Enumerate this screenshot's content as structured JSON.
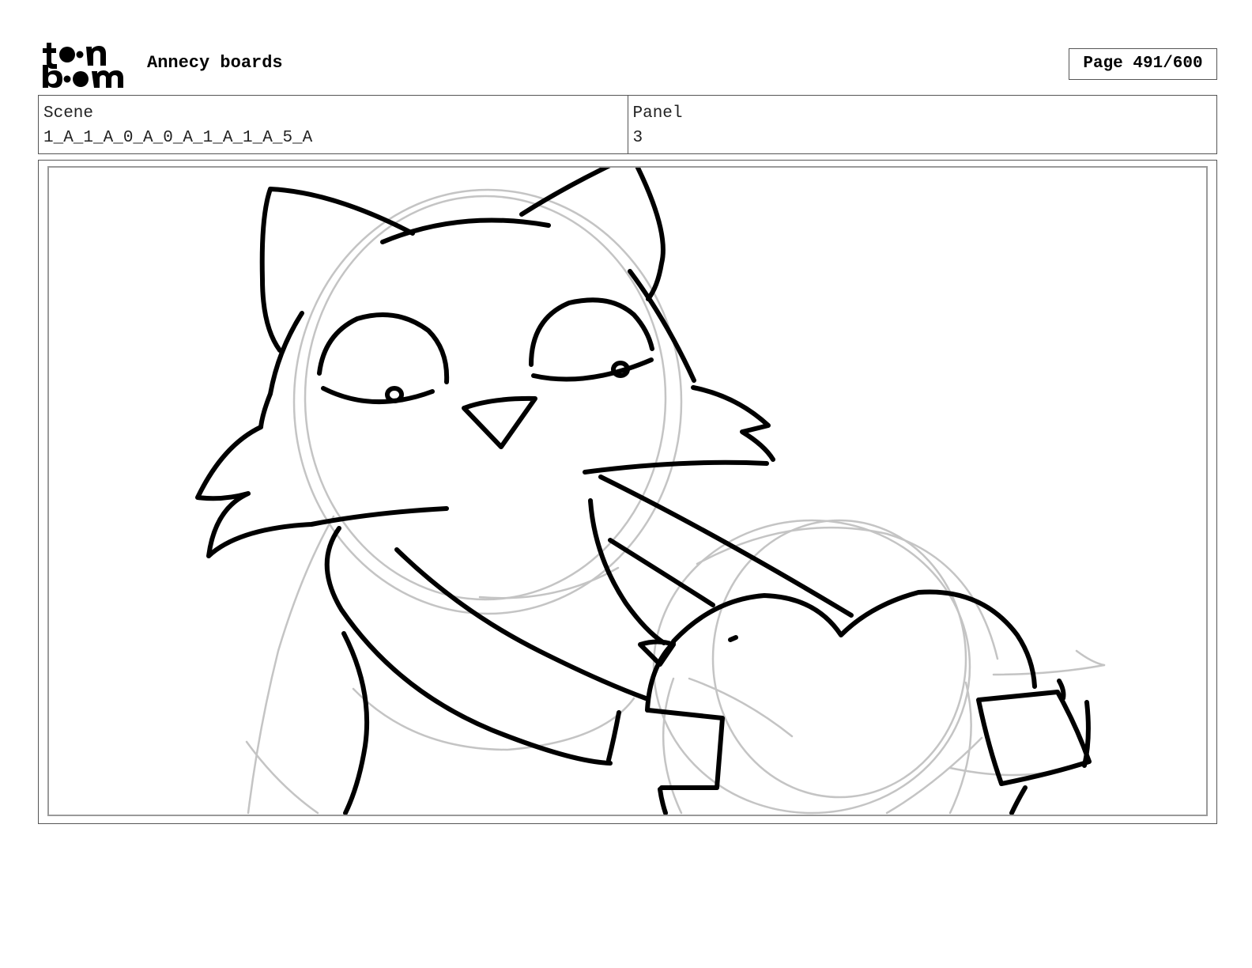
{
  "header": {
    "logo_text": "toonboom",
    "project_title": "Annecy boards",
    "page_label": "Page 491/600"
  },
  "info": {
    "scene_label": "Scene",
    "scene_value": "1_A_1_A_0_A_0_A_1_A_1_A_5_A",
    "panel_label": "Panel",
    "panel_value": "3"
  },
  "panel": {
    "content": "cat-with-heart-sketch"
  },
  "colors": {
    "ink": "#000000",
    "rough_sketch": "#c4c4c4",
    "frame_border": "#555555",
    "inner_border": "#9a9a9a"
  }
}
